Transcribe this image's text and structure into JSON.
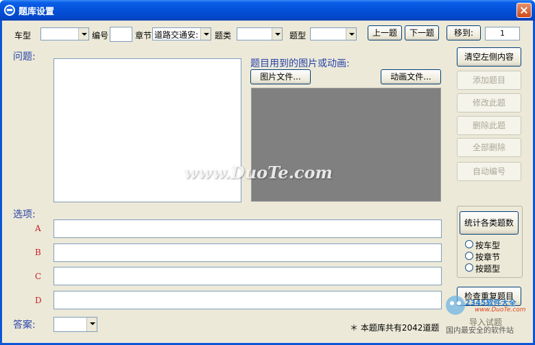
{
  "window": {
    "title": "题库设置"
  },
  "toolbar": {
    "car_type_label": "车型",
    "car_type_value": "",
    "number_label": "编号",
    "number_value": "",
    "chapter_label": "章节",
    "chapter_value": "道路交通安:",
    "category_label": "题类",
    "category_value": "",
    "qtype_label": "题型",
    "qtype_value": "",
    "prev_label": "上一题",
    "next_label": "下一题",
    "goto_label": "移到:",
    "goto_value": "1"
  },
  "question": {
    "label": "问题:",
    "media_label": "题目用到的图片或动画:",
    "picture_button": "图片文件...",
    "animation_button": "动画文件..."
  },
  "side_buttons": {
    "clear": "清空左侧内容",
    "add": "添加题目",
    "edit": "修改此题",
    "delete": "删除此题",
    "delete_all": "全部删除",
    "auto_number": "自动编号"
  },
  "options": {
    "label": "选项:",
    "items": [
      "A",
      "B",
      "C",
      "D"
    ]
  },
  "stats": {
    "button": "统计各类题数",
    "radios": [
      "按车型",
      "按章节",
      "按题型"
    ]
  },
  "check_duplicate": "检查重复题目",
  "import_label": "导入试题",
  "answer": {
    "label": "答案:",
    "value": ""
  },
  "footer": {
    "total": "＊ 本题库共有2042道题"
  },
  "watermark": {
    "main": "www.DuoTe.com",
    "corner_top": "2345软件大全",
    "corner_url": "www.DuoTe.com",
    "corner_bottom": "国内最安全的软件站"
  },
  "colors": {
    "titlebar": "#0450d8",
    "client": "#ece9d8",
    "media_area": "#808080",
    "blue_label": "#2743a8",
    "red_letter": "#c0202c"
  }
}
